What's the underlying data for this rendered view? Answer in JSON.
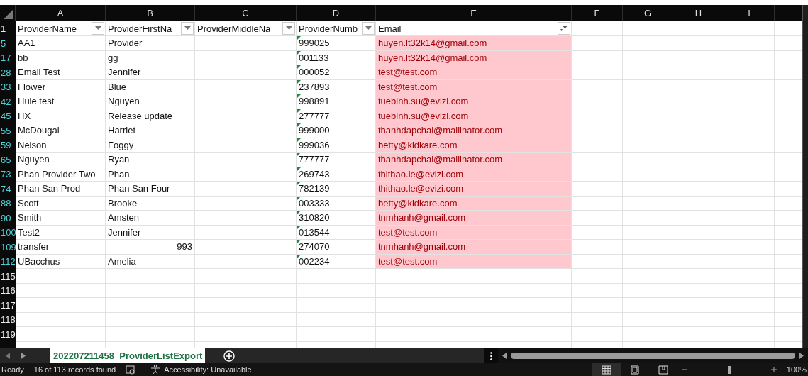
{
  "columns": [
    {
      "letter": "A"
    },
    {
      "letter": "B"
    },
    {
      "letter": "C"
    },
    {
      "letter": "D"
    },
    {
      "letter": "E"
    },
    {
      "letter": "F"
    },
    {
      "letter": "G"
    },
    {
      "letter": "H"
    },
    {
      "letter": "I"
    }
  ],
  "header_row": {
    "number": "1",
    "cells": [
      {
        "label": "ProviderName",
        "filter_active": false
      },
      {
        "label": "ProviderFirstNa",
        "filter_active": false
      },
      {
        "label": "ProviderMiddleNa",
        "filter_active": false
      },
      {
        "label": "ProviderNumb",
        "filter_active": false
      },
      {
        "label": "Email",
        "filter_active": true
      }
    ]
  },
  "rows": [
    {
      "number": "5",
      "filtered": true,
      "name": "AA1",
      "first": "Provider",
      "first_numeric": false,
      "provider_number": "999025",
      "number_as_text": true,
      "email": "huyen.lt32k14@gmail.com",
      "highlighted": true
    },
    {
      "number": "17",
      "filtered": true,
      "name": "bb",
      "first": "gg",
      "first_numeric": false,
      "provider_number": "001133",
      "number_as_text": true,
      "email": "huyen.lt32k14@gmail.com",
      "highlighted": true
    },
    {
      "number": "28",
      "filtered": true,
      "name": "Email Test",
      "first": "Jennifer",
      "first_numeric": false,
      "provider_number": "000052",
      "number_as_text": true,
      "email": "test@test.com",
      "highlighted": true
    },
    {
      "number": "33",
      "filtered": true,
      "name": "Flower",
      "first": "Blue",
      "first_numeric": false,
      "provider_number": "237893",
      "number_as_text": true,
      "email": "test@test.com",
      "highlighted": true
    },
    {
      "number": "42",
      "filtered": true,
      "name": "Hule test",
      "first": "Nguyen",
      "first_numeric": false,
      "provider_number": "998891",
      "number_as_text": true,
      "email": "tuebinh.su@evizi.com",
      "highlighted": true
    },
    {
      "number": "45",
      "filtered": true,
      "name": "HX",
      "first": "Release update",
      "first_numeric": false,
      "provider_number": "277777",
      "number_as_text": true,
      "email": "tuebinh.su@evizi.com",
      "highlighted": true
    },
    {
      "number": "55",
      "filtered": true,
      "name": "McDougal",
      "first": "Harriet",
      "first_numeric": false,
      "provider_number": "999000",
      "number_as_text": true,
      "email": "thanhdapchai@mailinator.com",
      "highlighted": true
    },
    {
      "number": "59",
      "filtered": true,
      "name": "Nelson",
      "first": "Foggy",
      "first_numeric": false,
      "provider_number": "999036",
      "number_as_text": true,
      "email": "betty@kidkare.com",
      "highlighted": true
    },
    {
      "number": "65",
      "filtered": true,
      "name": "Nguyen",
      "first": "Ryan",
      "first_numeric": false,
      "provider_number": "777777",
      "number_as_text": true,
      "email": "thanhdapchai@mailinator.com",
      "highlighted": true
    },
    {
      "number": "73",
      "filtered": true,
      "name": "Phan Provider Two",
      "first": "Phan",
      "first_numeric": false,
      "provider_number": "269743",
      "number_as_text": true,
      "email": "thithao.le@evizi.com",
      "highlighted": true
    },
    {
      "number": "74",
      "filtered": true,
      "name": "Phan San Prod",
      "first": "Phan San Four",
      "first_numeric": false,
      "provider_number": "782139",
      "number_as_text": true,
      "email": "thithao.le@evizi.com",
      "highlighted": true
    },
    {
      "number": "88",
      "filtered": true,
      "name": "Scott",
      "first": "Brooke",
      "first_numeric": false,
      "provider_number": "003333",
      "number_as_text": true,
      "email": "betty@kidkare.com",
      "highlighted": true
    },
    {
      "number": "90",
      "filtered": true,
      "name": "Smith",
      "first": "Amsten",
      "first_numeric": false,
      "provider_number": "310820",
      "number_as_text": true,
      "email": "tnmhanh@gmail.com",
      "highlighted": true
    },
    {
      "number": "100",
      "filtered": true,
      "name": "Test2",
      "first": "Jennifer",
      "first_numeric": false,
      "provider_number": "013544",
      "number_as_text": true,
      "email": "test@test.com",
      "highlighted": true
    },
    {
      "number": "109",
      "filtered": true,
      "name": "transfer",
      "first": "993",
      "first_numeric": true,
      "provider_number": "274070",
      "number_as_text": true,
      "email": "tnmhanh@gmail.com",
      "highlighted": true
    },
    {
      "number": "112",
      "filtered": true,
      "name": "UBacchus",
      "first": "Amelia",
      "first_numeric": false,
      "provider_number": "002234",
      "number_as_text": true,
      "email": "test@test.com",
      "highlighted": true
    },
    {
      "number": "115",
      "filtered": false
    },
    {
      "number": "116",
      "filtered": false
    },
    {
      "number": "117",
      "filtered": false
    },
    {
      "number": "118",
      "filtered": false
    },
    {
      "number": "119",
      "filtered": false
    }
  ],
  "sheet_tabs": [
    {
      "label": "202207211458_ProviderListExport",
      "selected": true
    }
  ],
  "status_bar": {
    "mode": "Ready",
    "records": "16 of 113 records found",
    "accessibility": "Accessibility: Unavailable",
    "views": [
      {
        "kind": "normal",
        "selected": true
      },
      {
        "kind": "page-layout",
        "selected": false
      },
      {
        "kind": "page-break",
        "selected": false
      }
    ],
    "zoom": {
      "level": 0.5,
      "reading": "100%"
    }
  }
}
